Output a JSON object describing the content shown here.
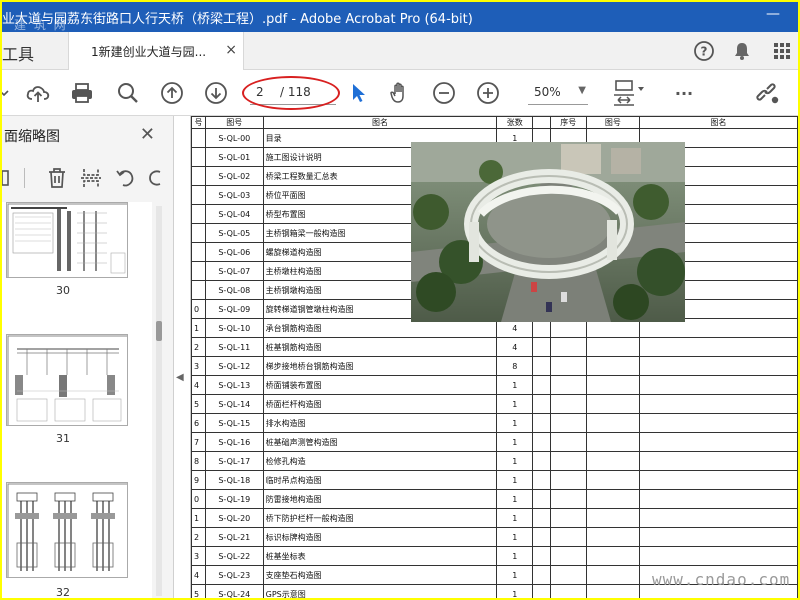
{
  "window": {
    "title": "业大道与园荔东街路口人行天桥（桥梁工程）.pdf - Adobe Acrobat Pro (64-bit)",
    "title_watermark": "建 筑 网"
  },
  "tabs": {
    "tools_label": "工具",
    "doc_tab_label": "1新建创业大道与园...",
    "close_glyph": "×"
  },
  "toolbar": {
    "current_page": "2",
    "total_pages": "/ 118",
    "zoom": "50%",
    "more_glyph": "···"
  },
  "left_panel": {
    "title": "面缩略图",
    "close_glyph": "✕",
    "thumb_numbers": [
      "30",
      "31",
      "32"
    ]
  },
  "table": {
    "header": {
      "no": "号",
      "code": "图号",
      "name": "图名",
      "count": "张数",
      "no2": "序号",
      "code2": "图号",
      "name2": "图名"
    },
    "rows": [
      {
        "no": "",
        "code": "S-QL-00",
        "name": "目录",
        "count": "1"
      },
      {
        "no": "",
        "code": "S-QL-01",
        "name": "施工图设计说明",
        "count": ""
      },
      {
        "no": "",
        "code": "S-QL-02",
        "name": "桥梁工程数量汇总表",
        "count": ""
      },
      {
        "no": "",
        "code": "S-QL-03",
        "name": "桥位平面图",
        "count": ""
      },
      {
        "no": "",
        "code": "S-QL-04",
        "name": "桥型布置图",
        "count": ""
      },
      {
        "no": "",
        "code": "S-QL-05",
        "name": "主桥钢箱梁一般构造图",
        "count": ""
      },
      {
        "no": "",
        "code": "S-QL-06",
        "name": "螺旋梯道构造图",
        "count": ""
      },
      {
        "no": "",
        "code": "S-QL-07",
        "name": "主桥墩柱构造图",
        "count": ""
      },
      {
        "no": "",
        "code": "S-QL-08",
        "name": "主桥钢墩构造图",
        "count": ""
      },
      {
        "no": "0",
        "code": "S-QL-09",
        "name": "旋转梯道钢管墩柱构造图",
        "count": ""
      },
      {
        "no": "1",
        "code": "S-QL-10",
        "name": "承台钢筋构造图",
        "count": "4"
      },
      {
        "no": "2",
        "code": "S-QL-11",
        "name": "桩基钢筋构造图",
        "count": "4"
      },
      {
        "no": "3",
        "code": "S-QL-12",
        "name": "梯步接地桥台钢筋构造图",
        "count": "8"
      },
      {
        "no": "4",
        "code": "S-QL-13",
        "name": "桥面铺装布置图",
        "count": "1"
      },
      {
        "no": "5",
        "code": "S-QL-14",
        "name": "桥面栏杆构造图",
        "count": "1"
      },
      {
        "no": "6",
        "code": "S-QL-15",
        "name": "排水构造图",
        "count": "1"
      },
      {
        "no": "7",
        "code": "S-QL-16",
        "name": "桩基础声测管构造图",
        "count": "1"
      },
      {
        "no": "8",
        "code": "S-QL-17",
        "name": "检修孔构造",
        "count": "1"
      },
      {
        "no": "9",
        "code": "S-QL-18",
        "name": "临时吊点构造图",
        "count": "1"
      },
      {
        "no": "0",
        "code": "S-QL-19",
        "name": "防雷接地构造图",
        "count": "1"
      },
      {
        "no": "1",
        "code": "S-QL-20",
        "name": "桥下防护栏杆一般构造图",
        "count": "1"
      },
      {
        "no": "2",
        "code": "S-QL-21",
        "name": "标识标牌构造图",
        "count": "1"
      },
      {
        "no": "3",
        "code": "S-QL-22",
        "name": "桩基坐标表",
        "count": "1"
      },
      {
        "no": "4",
        "code": "S-QL-23",
        "name": "支座垫石构造图",
        "count": "1"
      },
      {
        "no": "5",
        "code": "S-QL-24",
        "name": "GPS示意图",
        "count": "1"
      }
    ]
  },
  "site_watermark": "www.cndao.com"
}
